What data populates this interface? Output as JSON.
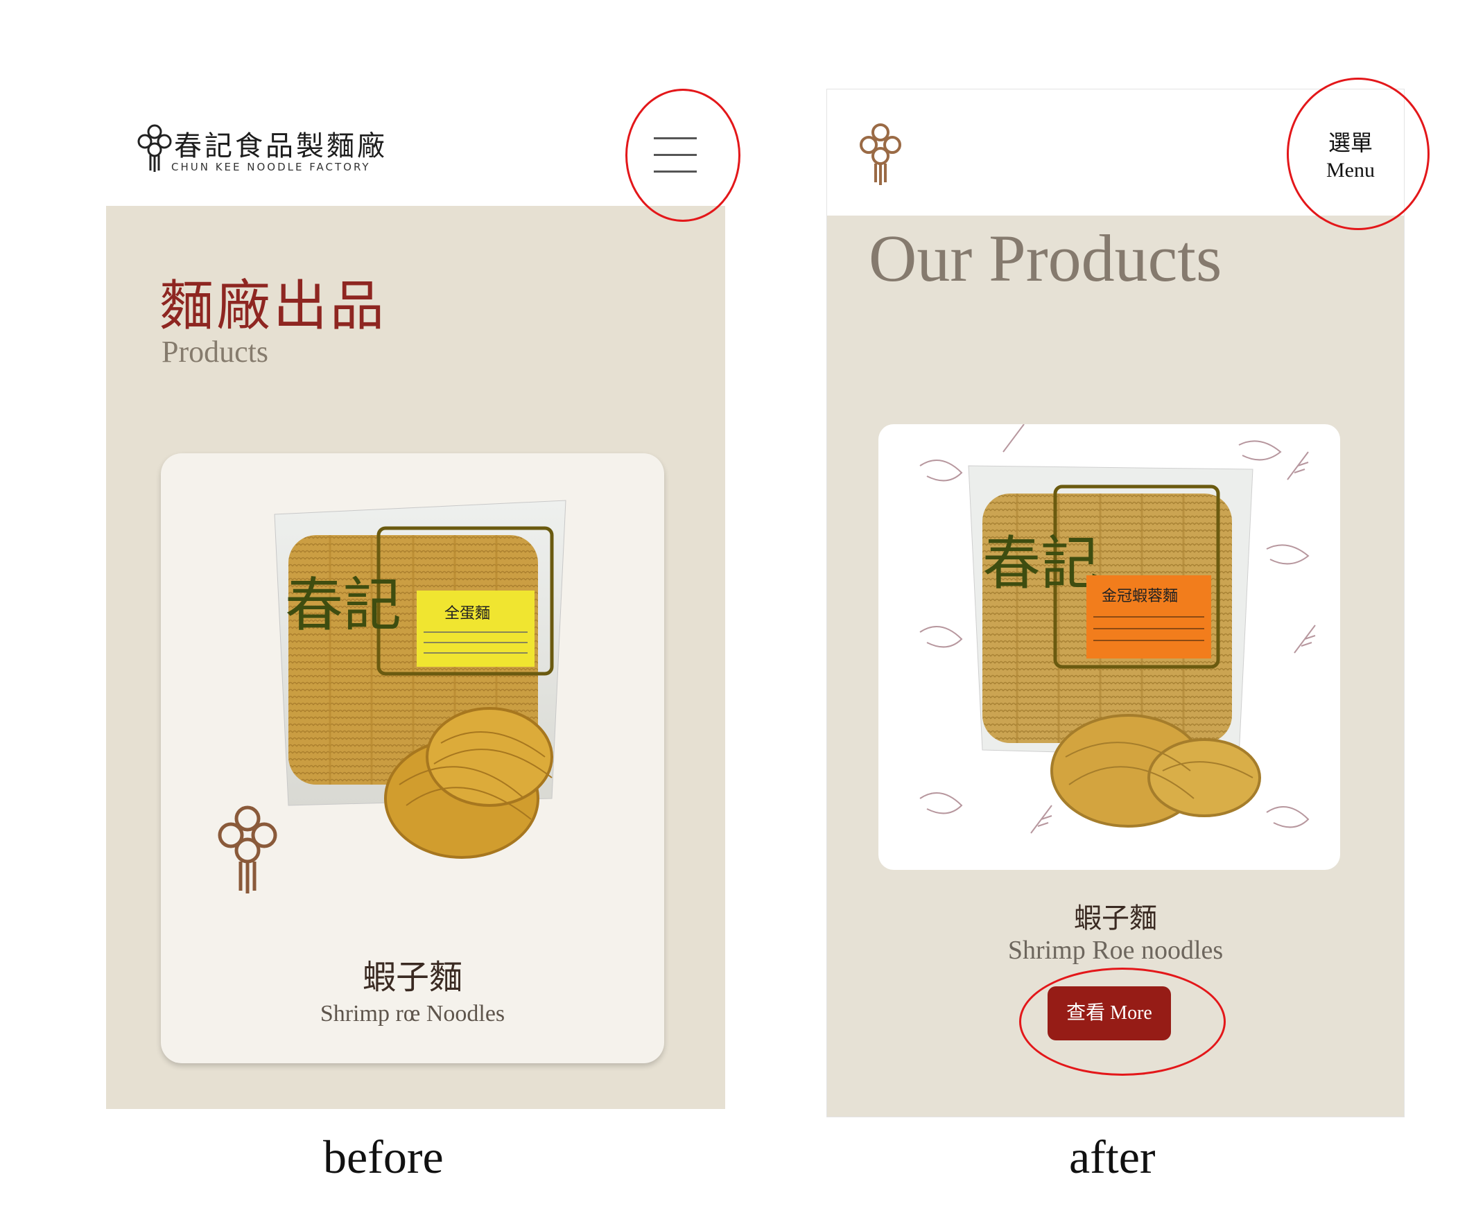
{
  "before": {
    "logo_cn": "春記食品製麵廠",
    "logo_en": "CHUN KEE NOODLE FACTORY",
    "section_title_cn": "麵廠出品",
    "section_title_en": "Products",
    "product_name_cn": "蝦子麵",
    "product_name_en": "Shrimp rœ Noodles",
    "package_brand": "春記",
    "package_label": "全蛋麵",
    "caption": "before"
  },
  "after": {
    "menu_cn": "選單",
    "menu_en": "Menu",
    "section_title": "Our Products",
    "product_name_cn": "蝦子麵",
    "product_name_en": "Shrimp Roe noodles",
    "more_button": "查看 More",
    "package_brand": "春記",
    "package_label": "金冠蝦蓉麵",
    "caption": "after"
  },
  "colors": {
    "beige_bg": "#e6e0d2",
    "brand_red": "#961c16",
    "title_red": "#8e2621",
    "annotation_red": "#e3171a"
  }
}
